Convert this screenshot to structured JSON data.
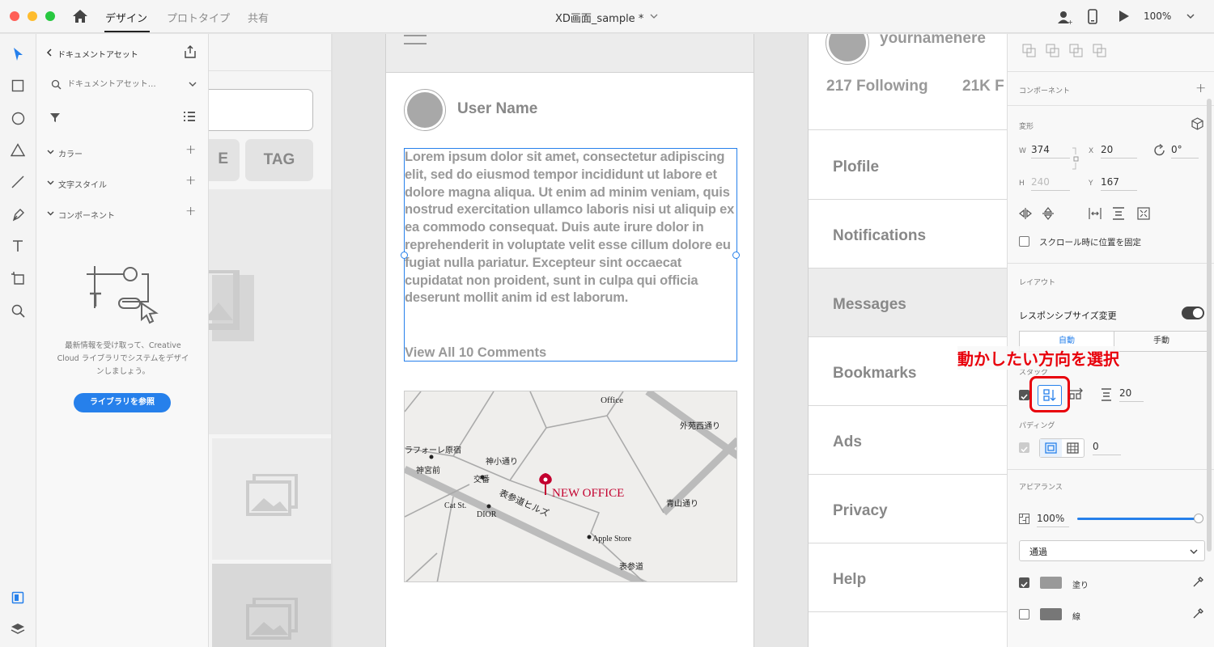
{
  "titlebar": {
    "tabs": [
      "デザイン",
      "プロトタイプ",
      "共有"
    ],
    "document_title": "XD画面_sample *",
    "zoom": "100%"
  },
  "assets": {
    "back_label": "ドキュメントアセット",
    "search_placeholder": "ドキュメントアセット…",
    "sections": [
      "カラー",
      "文字スタイル",
      "コンポーネント"
    ],
    "cc_message": "最新情報を受け取って、Creative Cloud ライブラリでシステムをデザインしましょう。",
    "library_button": "ライブラリを参照"
  },
  "canvas": {
    "left_artboard": {
      "tag_partial": "E",
      "tag": "TAG"
    },
    "post": {
      "user_name": "User Name",
      "body": "Lorem ipsum dolor sit amet, consectetur adipiscing elit, sed do eiusmod tempor incididunt ut labore et dolore magna aliqua. Ut enim ad minim veniam, quis nostrud exercitation ullamco laboris nisi ut aliquip ex ea commodo consequat. Duis aute irure dolor in reprehenderit in voluptate velit esse cillum dolore eu fugiat nulla pariatur. Excepteur sint occaecat cupidatat non proident, sunt in culpa qui officia deserunt mollit anim id est laborum.",
      "comments": "View All 10 Comments"
    },
    "map": {
      "labels": [
        "Office",
        "外苑西通り",
        "ラフォーレ原宿",
        "神小通り",
        "神宮前",
        "交番",
        "表参道ヒルズ",
        "Cat St.",
        "DIOR",
        "青山通り",
        "Apple Store",
        "表参道"
      ],
      "pin_label": "NEW OFFICE"
    },
    "profile": {
      "username": "yournamehere",
      "following": "217 Following",
      "followers": "21K F",
      "menu": [
        "Plofile",
        "Notifications",
        "Messages",
        "Bookmarks",
        "Ads",
        "Privacy",
        "Help"
      ]
    }
  },
  "props": {
    "component_label": "コンポーネント",
    "transform_label": "変形",
    "w_label": "W",
    "w": "374",
    "x_label": "X",
    "x": "20",
    "rotation": "0°",
    "h_label": "H",
    "h": "240",
    "y_label": "Y",
    "y": "167",
    "fix_scroll": "スクロール時に位置を固定",
    "layout_label": "レイアウト",
    "responsive": "レスポンシブサイズ変更",
    "auto": "自動",
    "manual": "手動",
    "stack_label": "スタック",
    "stack_gap": "20",
    "padding_label": "パディング",
    "padding": "0",
    "appearance_label": "アピアランス",
    "opacity": "100%",
    "blend": "通過",
    "fill": "塗り",
    "stroke": "線"
  },
  "annotation": {
    "text": "動かしたい方向を選択",
    "color": "#e8000b"
  },
  "colors": {
    "accent": "#2680eb",
    "pin": "#c3002f"
  }
}
